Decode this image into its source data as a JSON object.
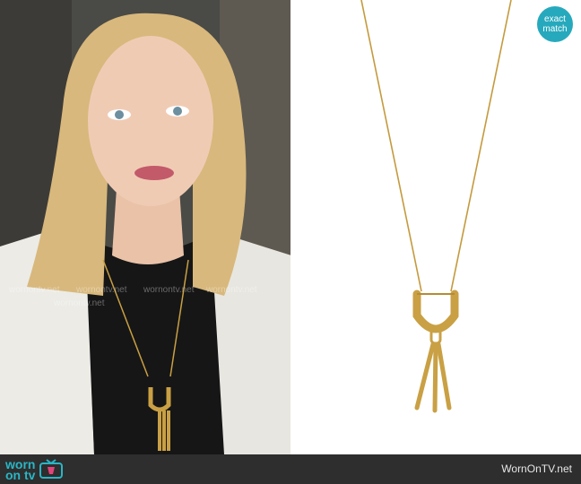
{
  "badge": {
    "line1": "exact",
    "line2": "match"
  },
  "footer": {
    "brand_top": "worn",
    "brand_bottom": "on tv",
    "site": "WornOnTV.net"
  },
  "watermarks": [
    "wornontv.net",
    "wornontv.net",
    "wornontv.net",
    "wornontv.net",
    "wornontv.net"
  ],
  "icons": [
    "tv-icon"
  ],
  "colors": {
    "accent": "#29b6c6",
    "gold": "#c9a044",
    "footer": "#2e2e2e"
  }
}
